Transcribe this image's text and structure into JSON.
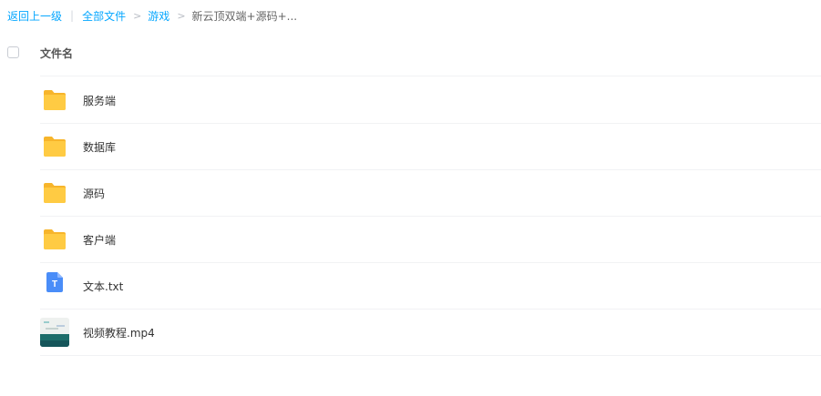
{
  "breadcrumb": {
    "back_label": "返回上一级",
    "separator": "|",
    "root_label": "全部文件",
    "arrow": ">",
    "level1_label": "游戏",
    "current_label": "新云顶双端+源码+..."
  },
  "header": {
    "name_column": "文件名"
  },
  "files": [
    {
      "name": "服务端",
      "icon": "folder-icon"
    },
    {
      "name": "数据库",
      "icon": "folder-icon"
    },
    {
      "name": "源码",
      "icon": "folder-icon"
    },
    {
      "name": "客户端",
      "icon": "folder-icon"
    },
    {
      "name": "文本.txt",
      "icon": "txt-file-icon",
      "icon_letter": "T"
    },
    {
      "name": "视频教程.mp4",
      "icon": "video-thumbnail"
    }
  ],
  "colors": {
    "link": "#06a7ff",
    "folder": "#ffc93d",
    "txt_icon": "#4a8df8"
  }
}
